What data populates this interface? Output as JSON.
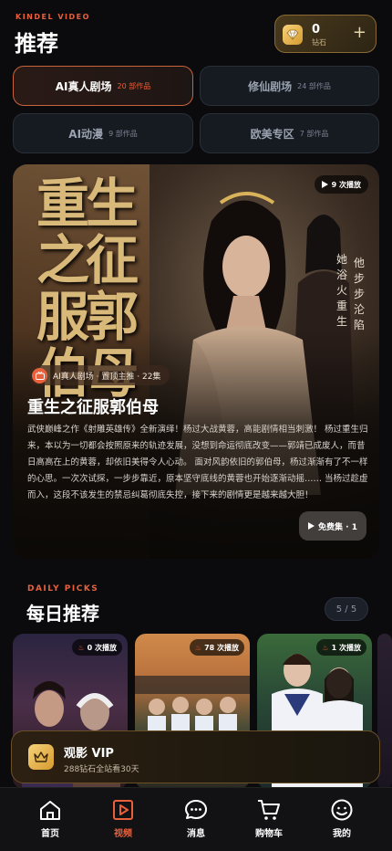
{
  "header": {
    "brand": "KINDEL VIDEO",
    "title": "推荐"
  },
  "wallet": {
    "count": "0",
    "label": "钻石",
    "plus": "+"
  },
  "categories": [
    {
      "name": "AI真人剧场",
      "count": "20 部作品",
      "active": true
    },
    {
      "name": "修仙剧场",
      "count": "24 部作品",
      "active": false
    },
    {
      "name": "AI动漫",
      "count": "9 部作品",
      "active": false
    },
    {
      "name": "欧美专区",
      "count": "7 部作品",
      "active": false
    }
  ],
  "featured": {
    "poster_title": "重生之征服郭伯母",
    "poster_side_1": "她浴火重生",
    "poster_side_2": "他步步沦陷",
    "views": "9 次播放",
    "tag": "AI真人剧场 · 置顶主推 · 22集",
    "title": "重生之征服郭伯母",
    "description": "武侠巅峰之作《射雕英雄传》全新演绎！杨过大战黄蓉，高能剧情相当刺激！ 杨过重生归来，本以为一切都会按照原来的轨迹发展，没想到命运彻底改变——郭靖已成废人，而昔日高高在上的黄蓉，却依旧美得令人心动。 面对风韵依旧的郭伯母，杨过渐渐有了不一样的心思。一次次试探，一步步靠近，原本坚守底线的黄蓉也开始逐渐动摇…… 当杨过趁虚而入，这段不该发生的禁忌纠葛彻底失控，接下来的剧情更是越来越大胆！",
    "free_button": "免费集 · 1"
  },
  "daily": {
    "label": "DAILY PICKS",
    "title": "每日推荐",
    "pager": "5 / 5",
    "cards": [
      {
        "views": "0 次播放"
      },
      {
        "views": "78 次播放"
      },
      {
        "views": "1 次播放"
      }
    ]
  },
  "vip": {
    "title": "观影 VIP",
    "subtitle": "288钻石全站看30天"
  },
  "tabs": [
    {
      "label": "首页",
      "icon": "home-icon"
    },
    {
      "label": "视频",
      "icon": "video-icon",
      "active": true
    },
    {
      "label": "消息",
      "icon": "message-icon"
    },
    {
      "label": "购物车",
      "icon": "cart-icon"
    },
    {
      "label": "我的",
      "icon": "profile-icon"
    }
  ],
  "colors": {
    "accent": "#e8603c",
    "gold": "#d69a2e",
    "background": "#0b0b0e"
  }
}
